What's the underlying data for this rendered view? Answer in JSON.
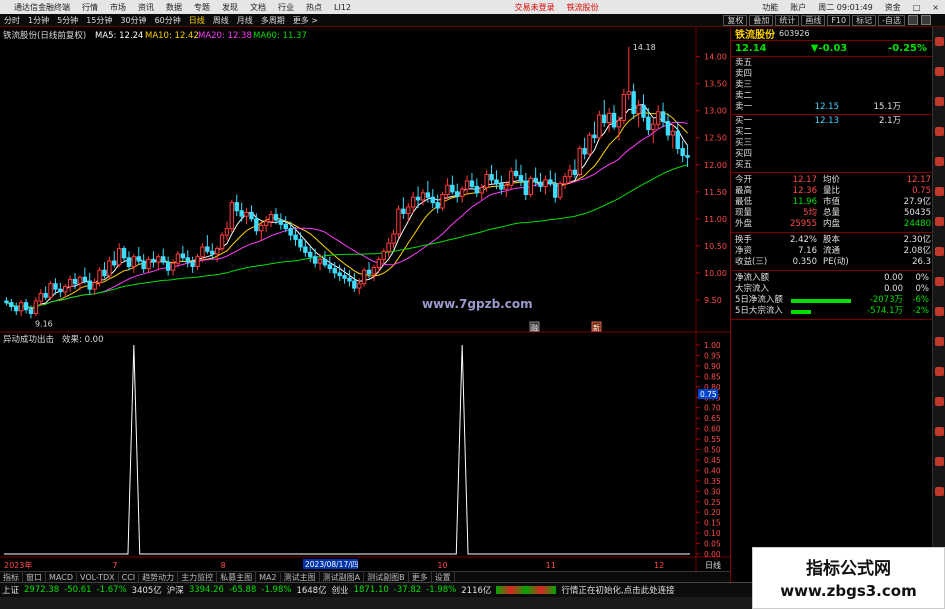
{
  "menubar": {
    "app_title": "通达信金融终端",
    "menus": [
      "行情",
      "市场",
      "资讯",
      "数据",
      "专题",
      "发现",
      "文档",
      "行业",
      "热点",
      "LI12"
    ],
    "center_links": [
      "交易未登录",
      "铁流股份"
    ],
    "right": [
      "功能",
      "账户",
      "周二 09:01:49",
      "资金",
      "□",
      "×"
    ]
  },
  "toolbar": {
    "periods": [
      "分时",
      "1分钟",
      "5分钟",
      "15分钟",
      "30分钟",
      "60分钟",
      "日线",
      "周线",
      "月线",
      "多周期",
      "更多 >"
    ],
    "selected": "日线",
    "right_buttons": [
      "复权",
      "叠加",
      "统计",
      "画线",
      "F10",
      "标记",
      "-自选"
    ]
  },
  "main_chart": {
    "title": "铁流股份(日线前复权)",
    "ma_labels": [
      {
        "text": "MA5: 12.24",
        "color": "#ffffff"
      },
      {
        "text": "MA10: 12.42",
        "color": "#ffd200"
      },
      {
        "text": "MA20: 12.38",
        "color": "#ff3cff"
      },
      {
        "text": "MA60: 11.37",
        "color": "#00e000"
      }
    ],
    "y_ticks": [
      "14.00",
      "13.50",
      "13.00",
      "12.50",
      "12.00",
      "11.50",
      "11.00",
      "10.50",
      "10.00",
      "9.50"
    ],
    "high_label": "14.18",
    "low_label": "9.16",
    "watermark": "www.7gpzb.com",
    "markers": [
      "融",
      "新"
    ]
  },
  "sub_chart": {
    "title": "异动成功出击",
    "value_label": "效果: 0.00",
    "y_ticks": [
      "1.00",
      "0.95",
      "0.90",
      "0.85",
      "0.80",
      "0.75",
      "0.70",
      "0.65",
      "0.60",
      "0.55",
      "0.50",
      "0.45",
      "0.40",
      "0.35",
      "0.30",
      "0.25",
      "0.20",
      "0.15",
      "0.10",
      "0.05",
      "0.00"
    ],
    "marker_value": "0.75"
  },
  "x_axis": {
    "labels": [
      "2023年",
      "7",
      "8",
      "9",
      "10",
      "11",
      "12"
    ],
    "highlight_date": "2023/08/17/四",
    "right_label": "日线"
  },
  "chart_data": [
    {
      "type": "candlestick",
      "title": "铁流股份(日线前复权)",
      "ylim": [
        9.0,
        14.4
      ],
      "ohlc": [
        [
          9.48,
          9.55,
          9.4,
          9.45
        ],
        [
          9.45,
          9.52,
          9.3,
          9.38
        ],
        [
          9.38,
          9.45,
          9.22,
          9.3
        ],
        [
          9.3,
          9.5,
          9.2,
          9.45
        ],
        [
          9.45,
          9.52,
          9.25,
          9.32
        ],
        [
          9.32,
          9.4,
          9.16,
          9.25
        ],
        [
          9.25,
          9.55,
          9.2,
          9.48
        ],
        [
          9.48,
          9.7,
          9.4,
          9.62
        ],
        [
          9.62,
          9.75,
          9.5,
          9.55
        ],
        [
          9.55,
          9.85,
          9.5,
          9.8
        ],
        [
          9.8,
          9.9,
          9.6,
          9.7
        ],
        [
          9.7,
          9.82,
          9.55,
          9.65
        ],
        [
          9.65,
          9.8,
          9.55,
          9.75
        ],
        [
          9.75,
          9.95,
          9.65,
          9.88
        ],
        [
          9.88,
          10.0,
          9.7,
          9.8
        ],
        [
          9.8,
          9.95,
          9.68,
          9.92
        ],
        [
          9.92,
          10.1,
          9.8,
          9.85
        ],
        [
          9.85,
          10.0,
          9.6,
          9.7
        ],
        [
          9.7,
          9.9,
          9.6,
          9.82
        ],
        [
          9.82,
          10.1,
          9.75,
          10.05
        ],
        [
          10.05,
          10.2,
          9.9,
          9.95
        ],
        [
          9.95,
          10.3,
          9.9,
          10.22
        ],
        [
          10.22,
          10.4,
          10.1,
          10.15
        ],
        [
          10.15,
          10.55,
          10.1,
          10.45
        ],
        [
          10.45,
          10.5,
          10.2,
          10.28
        ],
        [
          10.28,
          10.4,
          10.05,
          10.12
        ],
        [
          10.12,
          10.35,
          10.0,
          10.3
        ],
        [
          10.3,
          10.48,
          10.15,
          10.22
        ],
        [
          10.22,
          10.35,
          10.0,
          10.08
        ],
        [
          10.08,
          10.3,
          10.0,
          10.25
        ],
        [
          10.25,
          10.4,
          10.1,
          10.2
        ],
        [
          10.2,
          10.35,
          10.05,
          10.3
        ],
        [
          10.3,
          10.45,
          10.15,
          10.2
        ],
        [
          10.2,
          10.3,
          9.95,
          10.05
        ],
        [
          10.05,
          10.25,
          9.95,
          10.18
        ],
        [
          10.18,
          10.4,
          10.1,
          10.35
        ],
        [
          10.35,
          10.5,
          10.2,
          10.28
        ],
        [
          10.28,
          10.42,
          10.1,
          10.2
        ],
        [
          10.2,
          10.3,
          10.0,
          10.12
        ],
        [
          10.12,
          10.35,
          10.05,
          10.3
        ],
        [
          10.3,
          10.55,
          10.2,
          10.48
        ],
        [
          10.48,
          10.7,
          10.35,
          10.4
        ],
        [
          10.4,
          10.55,
          10.25,
          10.35
        ],
        [
          10.35,
          10.5,
          10.2,
          10.45
        ],
        [
          10.45,
          10.75,
          10.4,
          10.7
        ],
        [
          10.7,
          10.95,
          10.6,
          10.82
        ],
        [
          10.82,
          11.35,
          10.75,
          11.3
        ],
        [
          11.3,
          11.45,
          11.05,
          11.15
        ],
        [
          11.15,
          11.3,
          10.95,
          11.05
        ],
        [
          11.05,
          11.2,
          10.9,
          11.12
        ],
        [
          11.12,
          11.25,
          10.95,
          11.0
        ],
        [
          11.0,
          11.1,
          10.7,
          10.78
        ],
        [
          10.78,
          10.95,
          10.6,
          10.88
        ],
        [
          10.88,
          11.05,
          10.75,
          10.95
        ],
        [
          10.95,
          11.15,
          10.85,
          11.08
        ],
        [
          11.08,
          11.2,
          10.9,
          10.98
        ],
        [
          10.98,
          11.1,
          10.8,
          10.9
        ],
        [
          10.9,
          11.05,
          10.75,
          10.82
        ],
        [
          10.82,
          10.95,
          10.6,
          10.7
        ],
        [
          10.7,
          10.85,
          10.5,
          10.62
        ],
        [
          10.62,
          10.75,
          10.4,
          10.48
        ],
        [
          10.48,
          10.6,
          10.3,
          10.38
        ],
        [
          10.38,
          10.5,
          10.2,
          10.3
        ],
        [
          10.3,
          10.45,
          10.1,
          10.18
        ],
        [
          10.18,
          10.35,
          10.05,
          10.25
        ],
        [
          10.25,
          10.4,
          10.1,
          10.15
        ],
        [
          10.15,
          10.3,
          10.0,
          10.08
        ],
        [
          10.08,
          10.2,
          9.9,
          10.0
        ],
        [
          10.0,
          10.15,
          9.85,
          9.95
        ],
        [
          9.95,
          10.1,
          9.8,
          9.9
        ],
        [
          9.9,
          10.05,
          9.75,
          9.85
        ],
        [
          9.85,
          10.0,
          9.65,
          9.72
        ],
        [
          9.72,
          9.9,
          9.6,
          9.8
        ],
        [
          9.8,
          10.1,
          9.75,
          10.05
        ],
        [
          10.05,
          10.2,
          9.9,
          9.98
        ],
        [
          9.98,
          10.15,
          9.85,
          10.1
        ],
        [
          10.1,
          10.3,
          10.0,
          10.25
        ],
        [
          10.25,
          10.45,
          10.15,
          10.4
        ],
        [
          10.4,
          10.65,
          10.3,
          10.55
        ],
        [
          10.55,
          10.8,
          10.45,
          10.72
        ],
        [
          10.72,
          11.25,
          10.65,
          11.18
        ],
        [
          11.18,
          11.4,
          11.0,
          11.1
        ],
        [
          11.1,
          11.3,
          10.95,
          11.22
        ],
        [
          11.22,
          11.5,
          11.1,
          11.4
        ],
        [
          11.4,
          11.6,
          11.2,
          11.35
        ],
        [
          11.35,
          11.55,
          11.25,
          11.48
        ],
        [
          11.48,
          11.7,
          11.3,
          11.4
        ],
        [
          11.4,
          11.55,
          11.2,
          11.3
        ],
        [
          11.3,
          11.45,
          11.1,
          11.2
        ],
        [
          11.2,
          11.5,
          11.15,
          11.45
        ],
        [
          11.45,
          11.75,
          11.35,
          11.62
        ],
        [
          11.62,
          11.8,
          11.45,
          11.5
        ],
        [
          11.5,
          11.65,
          11.3,
          11.42
        ],
        [
          11.42,
          11.6,
          11.3,
          11.55
        ],
        [
          11.55,
          11.8,
          11.45,
          11.7
        ],
        [
          11.7,
          11.85,
          11.55,
          11.6
        ],
        [
          11.6,
          11.75,
          11.4,
          11.48
        ],
        [
          11.48,
          11.65,
          11.35,
          11.58
        ],
        [
          11.58,
          11.9,
          11.5,
          11.82
        ],
        [
          11.82,
          12.0,
          11.65,
          11.72
        ],
        [
          11.72,
          11.9,
          11.55,
          11.65
        ],
        [
          11.65,
          11.8,
          11.45,
          11.55
        ],
        [
          11.55,
          11.7,
          11.4,
          11.62
        ],
        [
          11.62,
          11.95,
          11.55,
          11.88
        ],
        [
          11.88,
          12.1,
          11.75,
          11.8
        ],
        [
          11.8,
          12.0,
          11.6,
          11.7
        ],
        [
          11.7,
          11.85,
          11.35,
          11.45
        ],
        [
          11.45,
          11.8,
          11.4,
          11.75
        ],
        [
          11.75,
          11.95,
          11.6,
          11.68
        ],
        [
          11.68,
          11.85,
          11.5,
          11.6
        ],
        [
          11.6,
          11.8,
          11.45,
          11.72
        ],
        [
          11.72,
          11.9,
          11.6,
          11.65
        ],
        [
          11.65,
          11.85,
          11.3,
          11.4
        ],
        [
          11.4,
          11.7,
          11.35,
          11.65
        ],
        [
          11.65,
          11.85,
          11.55,
          11.78
        ],
        [
          11.78,
          12.0,
          11.65,
          11.9
        ],
        [
          11.9,
          12.1,
          11.75,
          11.82
        ],
        [
          11.82,
          12.35,
          11.78,
          12.3
        ],
        [
          12.3,
          12.5,
          12.1,
          12.2
        ],
        [
          12.2,
          12.6,
          12.15,
          12.55
        ],
        [
          12.55,
          12.8,
          12.4,
          12.5
        ],
        [
          12.5,
          13.0,
          12.45,
          12.92
        ],
        [
          12.92,
          13.2,
          12.7,
          12.78
        ],
        [
          12.78,
          13.05,
          12.6,
          12.95
        ],
        [
          12.95,
          13.1,
          12.65,
          12.7
        ],
        [
          12.7,
          12.9,
          12.45,
          12.82
        ],
        [
          12.82,
          13.4,
          12.75,
          13.3
        ],
        [
          13.3,
          14.18,
          13.2,
          13.35
        ],
        [
          13.35,
          13.5,
          12.85,
          12.95
        ],
        [
          12.95,
          13.2,
          12.7,
          13.1
        ],
        [
          13.1,
          13.3,
          12.8,
          12.88
        ],
        [
          12.88,
          13.05,
          12.55,
          12.65
        ],
        [
          12.65,
          12.85,
          12.4,
          12.75
        ],
        [
          12.75,
          13.1,
          12.65,
          12.98
        ],
        [
          12.98,
          13.15,
          12.7,
          12.8
        ],
        [
          12.8,
          12.95,
          12.45,
          12.55
        ],
        [
          12.55,
          12.75,
          12.3,
          12.62
        ],
        [
          12.62,
          12.8,
          12.2,
          12.3
        ],
        [
          12.3,
          12.45,
          12.05,
          12.17
        ],
        [
          12.17,
          12.36,
          11.96,
          12.14
        ]
      ],
      "series": [
        {
          "name": "MA5",
          "color": "#ffffff",
          "last": 12.24
        },
        {
          "name": "MA10",
          "color": "#ffd200",
          "last": 12.42
        },
        {
          "name": "MA20",
          "color": "#ff3cff",
          "last": 12.38
        },
        {
          "name": "MA60",
          "color": "#00e000",
          "last": 11.37
        }
      ]
    },
    {
      "type": "line",
      "title": "异动成功出击",
      "ylim": [
        0,
        1
      ],
      "spikes": [
        {
          "index": 26,
          "value": 1.0
        },
        {
          "index": 93,
          "value": 1.0
        }
      ],
      "baseline": 0
    }
  ],
  "side": {
    "stock_name": "铁流股份",
    "stock_code": "603926",
    "price": "12.14",
    "change": "▼-0.03",
    "change_pct": "-0.25%",
    "asks": [
      {
        "label": "卖五",
        "price": "",
        "vol": ""
      },
      {
        "label": "卖四",
        "price": "",
        "vol": ""
      },
      {
        "label": "卖三",
        "price": "",
        "vol": ""
      },
      {
        "label": "卖二",
        "price": "",
        "vol": ""
      },
      {
        "label": "卖一",
        "price": "12.15",
        "vol": "15.1万"
      }
    ],
    "bids": [
      {
        "label": "买一",
        "price": "12.13",
        "vol": "2.1万"
      },
      {
        "label": "买二",
        "price": "",
        "vol": ""
      },
      {
        "label": "买三",
        "price": "",
        "vol": ""
      },
      {
        "label": "买四",
        "price": "",
        "vol": ""
      },
      {
        "label": "买五",
        "price": "",
        "vol": ""
      }
    ],
    "quote": [
      [
        "今开",
        "12.17",
        "均价",
        "12.17"
      ],
      [
        "最高",
        "12.36",
        "量比",
        "0.75"
      ],
      [
        "最低",
        "11.96",
        "市值",
        "27.9亿"
      ],
      [
        "现量",
        "5均",
        "总量",
        "50435"
      ],
      [
        "外盘",
        "25955",
        "内盘",
        "24480"
      ]
    ],
    "quote2": [
      [
        "换手",
        "2.42%",
        "股本",
        "2.30亿"
      ],
      [
        "净资",
        "7.16",
        "流通",
        "2.08亿"
      ],
      [
        "收益(三)",
        "0.350",
        "PE(动)",
        "26.3"
      ]
    ],
    "flows": [
      {
        "label": "净流入额",
        "value": "0.00",
        "pct": "0%"
      },
      {
        "label": "大宗流入",
        "value": "0.00",
        "pct": "0%"
      },
      {
        "label": "5日净流入额",
        "value": "-2073万",
        "pct": "-6%"
      },
      {
        "label": "5日大宗流入",
        "value": "-574.1万",
        "pct": "-2%"
      }
    ]
  },
  "indicator_tabs": [
    "指标",
    "窗口",
    "MACD",
    "VOL-TDX",
    "CCI",
    "趋势动力",
    "主力监控",
    "私募主图",
    "MA2",
    "测试主图",
    "测试副图A",
    "测试副图B",
    "更多",
    "设置"
  ],
  "status_bar": {
    "items": [
      {
        "name": "上证",
        "value": "2972.38",
        "chg": "-50.61",
        "pct": "-1.67%",
        "amt": "3405亿"
      },
      {
        "name": "沪深",
        "value": "3394.26",
        "chg": "-65.88",
        "pct": "-1.98%",
        "amt": "1648亿"
      },
      {
        "name": "创业",
        "value": "1871.10",
        "chg": "-37.82",
        "pct": "-1.98%",
        "amt": "2116亿"
      }
    ],
    "tail": "行情正在初始化,点击此处连接"
  },
  "watermark2": {
    "title": "指标公式网",
    "url": "www.zbgs3.com"
  },
  "colors": {
    "up": "#ff3b3b",
    "down": "#3fdcff",
    "ma5": "#ffffff",
    "ma10": "#ffd200",
    "ma20": "#ff3cff",
    "ma60": "#00e000",
    "frame": "#7a0000"
  }
}
